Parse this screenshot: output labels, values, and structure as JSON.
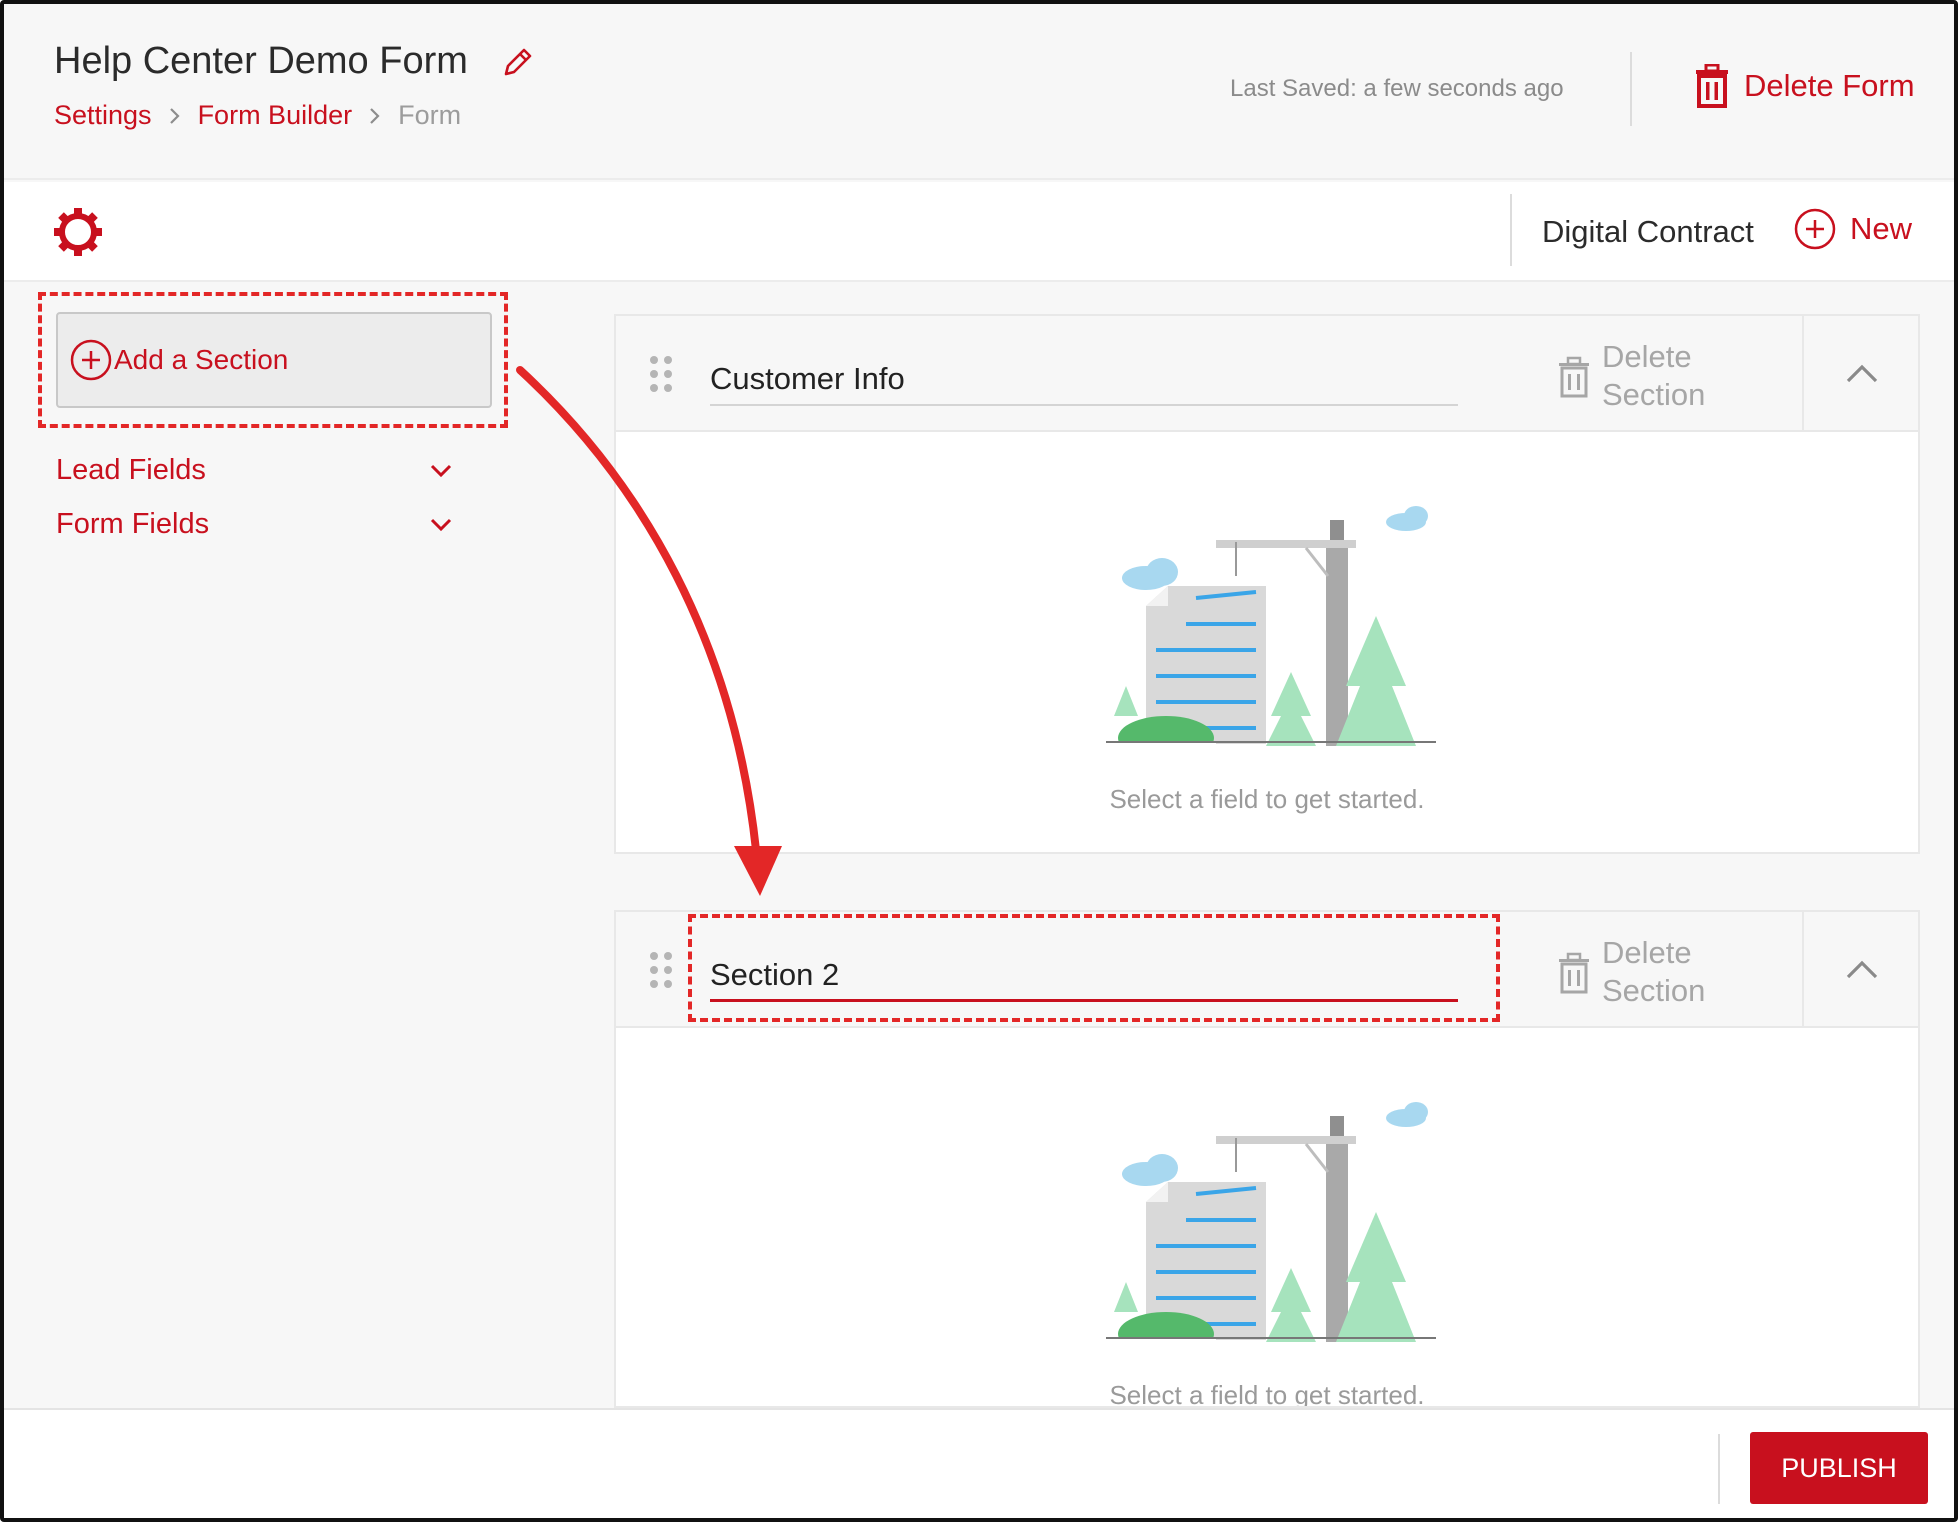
{
  "header": {
    "title": "Help Center Demo Form",
    "breadcrumb": [
      "Settings",
      "Form Builder",
      "Form"
    ],
    "last_saved_label": "Last Saved:",
    "last_saved_value": "a few seconds ago",
    "delete_form_label": "Delete Form"
  },
  "toolbar": {
    "contract_name": "Digital Contract",
    "new_label": "New"
  },
  "sidebar": {
    "add_section_label": "Add a Section",
    "accordions": [
      {
        "label": "Lead Fields",
        "expanded": false
      },
      {
        "label": "Form Fields",
        "expanded": false
      }
    ]
  },
  "sections": [
    {
      "title_value": "Customer Info",
      "delete_label_1": "Delete",
      "delete_label_2": "Section",
      "empty_message": "Select a field to get started.",
      "active": false
    },
    {
      "title_value": "Section 2",
      "delete_label_1": "Delete",
      "delete_label_2": "Section",
      "empty_message": "Select a field to get started.",
      "active": true
    }
  ],
  "footer": {
    "publish_label": "PUBLISH"
  },
  "colors": {
    "accent": "#c8101e",
    "annotation": "#e32727",
    "muted_text": "#9a9a9a",
    "background": "#f7f7f7"
  },
  "icons": [
    "edit-pencil-icon",
    "trash-icon",
    "gear-icon",
    "plus-circle-icon",
    "chevron-down-icon",
    "drag-handle-icon",
    "chevron-up-icon"
  ]
}
